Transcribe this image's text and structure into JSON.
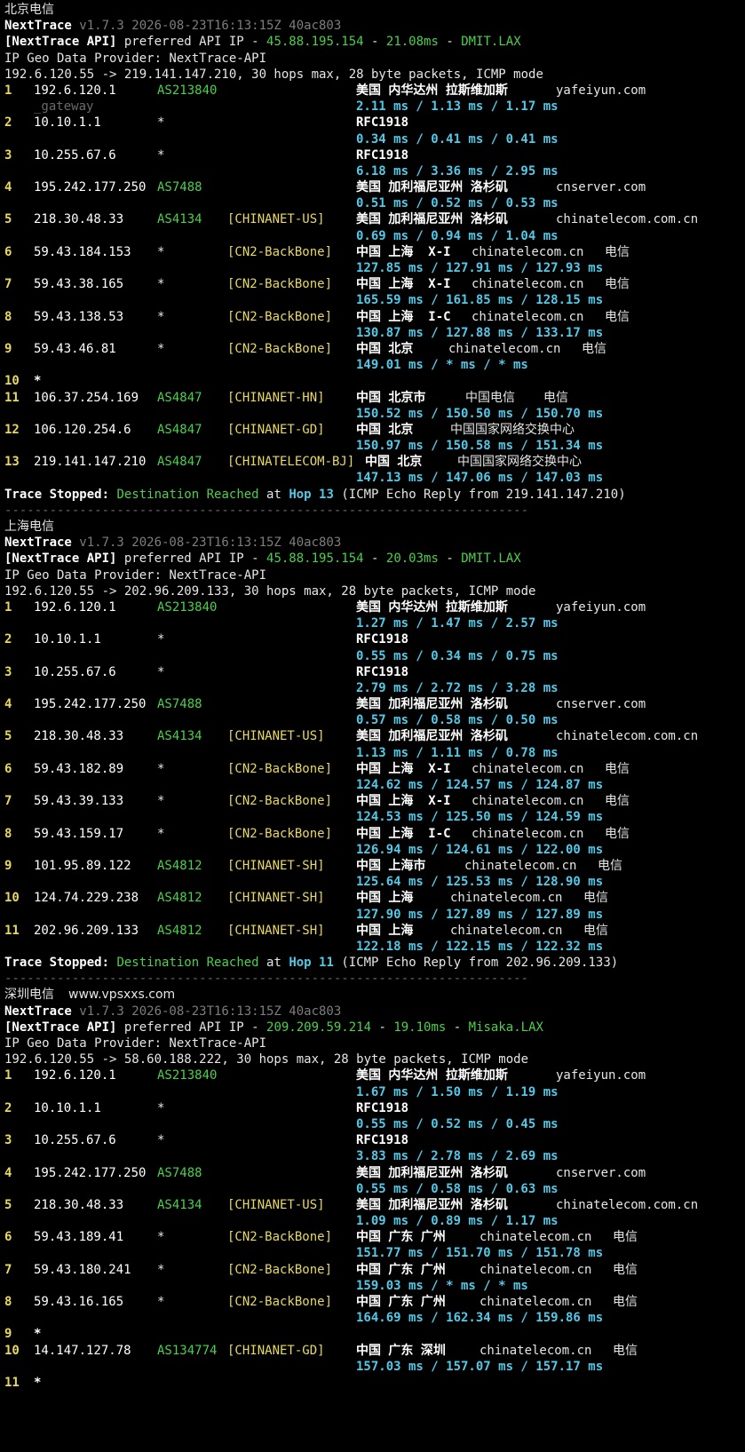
{
  "sections": [
    {
      "title": "北京电信",
      "extra": "",
      "version": "v1.7.3 2026-08-23T16:13:15Z 40ac803",
      "api_ip": "45.88.195.154",
      "api_latency": "21.08ms",
      "api_node": "DMIT.LAX",
      "geo_provider": "IP Geo Data Provider: NextTrace-API",
      "route": "192.6.120.55 -> 219.141.147.210, 30 hops max, 28 byte packets, ICMP mode",
      "hops": [
        {
          "n": "1",
          "ip": "192.6.120.1",
          "as": "AS213840",
          "tag": "",
          "geo": "美国 内华达州 拉斯维加斯",
          "dom": "yafeiyun.com",
          "isp": "",
          "dom_left": "621",
          "isp_left": "",
          "lat": "2.11 ms / 1.13 ms / 1.17 ms",
          "gw": "_gateway"
        },
        {
          "n": "2",
          "ip": "10.10.1.1",
          "as": "*",
          "tag": "",
          "geo": "RFC1918",
          "dom": "",
          "isp": "",
          "dom_left": "",
          "isp_left": "",
          "lat": "0.34 ms / 0.41 ms / 0.41 ms",
          "gw": ""
        },
        {
          "n": "3",
          "ip": "10.255.67.6",
          "as": "*",
          "tag": "",
          "geo": "RFC1918",
          "dom": "",
          "isp": "",
          "dom_left": "",
          "isp_left": "",
          "lat": "6.18 ms / 3.36 ms / 2.95 ms",
          "gw": ""
        },
        {
          "n": "4",
          "ip": "195.242.177.250",
          "as": "AS7488",
          "tag": "",
          "geo": "美国 加利福尼亚州 洛杉矶",
          "dom": "cnserver.com",
          "isp": "",
          "dom_left": "621",
          "isp_left": "",
          "lat": "0.51 ms / 0.52 ms / 0.53 ms",
          "gw": ""
        },
        {
          "n": "5",
          "ip": "218.30.48.33",
          "as": "AS4134",
          "tag": "[CHINANET-US]",
          "geo": "美国 加利福尼亚州 洛杉矶",
          "dom": "chinatelecom.com.cn",
          "isp": "",
          "dom_left": "621",
          "isp_left": "",
          "lat": "0.69 ms / 0.94 ms / 1.04 ms",
          "gw": ""
        },
        {
          "n": "6",
          "ip": "59.43.184.153",
          "as": "*",
          "tag": "[CN2-BackBone]",
          "geo": "中国 上海  X-I",
          "dom": "chinatelecom.cn",
          "isp": "电信",
          "dom_left": "526",
          "isp_left": "676",
          "lat": "127.85 ms / 127.91 ms / 127.93 ms",
          "gw": ""
        },
        {
          "n": "7",
          "ip": "59.43.38.165",
          "as": "*",
          "tag": "[CN2-BackBone]",
          "geo": "中国 上海  X-I",
          "dom": "chinatelecom.cn",
          "isp": "电信",
          "dom_left": "526",
          "isp_left": "676",
          "lat": "165.59 ms / 161.85 ms / 128.15 ms",
          "gw": ""
        },
        {
          "n": "8",
          "ip": "59.43.138.53",
          "as": "*",
          "tag": "[CN2-BackBone]",
          "geo": "中国 上海  I-C",
          "dom": "chinatelecom.cn",
          "isp": "电信",
          "dom_left": "526",
          "isp_left": "676",
          "lat": "130.87 ms / 127.88 ms / 133.17 ms",
          "gw": ""
        },
        {
          "n": "9",
          "ip": "59.43.46.81",
          "as": "*",
          "tag": "[CN2-BackBone]",
          "geo": "中国 北京",
          "dom": "chinatelecom.cn",
          "isp": "电信",
          "dom_left": "500",
          "isp_left": "650",
          "lat": "149.01 ms / * ms / * ms",
          "gw": ""
        },
        {
          "n": "10",
          "ip": "*",
          "as": "",
          "tag": "",
          "geo": "",
          "dom": "",
          "isp": "",
          "dom_left": "",
          "isp_left": "",
          "lat": "",
          "gw": ""
        },
        {
          "n": "11",
          "ip": "106.37.254.169",
          "as": "AS4847",
          "tag": "[CHINANET-HN]",
          "geo": "中国 北京市",
          "dom": "中国电信",
          "isp": "电信",
          "dom_left": "519",
          "isp_left": "607",
          "lat": "150.52 ms / 150.50 ms / 150.70 ms",
          "gw": ""
        },
        {
          "n": "12",
          "ip": "106.120.254.6",
          "as": "AS4847",
          "tag": "[CHINANET-GD]",
          "geo": "中国 北京",
          "dom": "中国国家网络交换中心",
          "isp": "",
          "dom_left": "502",
          "isp_left": "",
          "lat": "150.97 ms / 150.58 ms / 151.34 ms",
          "gw": ""
        },
        {
          "n": "13",
          "ip": "219.141.147.210",
          "as": "AS4847",
          "tag": "[CHINATELECOM-BJ]",
          "geo": "中国 北京",
          "dom": "中国国家网络交换中心",
          "isp": "",
          "dom_left": "510",
          "isp_left": "",
          "geo_left": "406",
          "lat": "147.13 ms / 147.06 ms / 147.03 ms",
          "gw": ""
        }
      ],
      "stop_hop": "Hop 13",
      "stop_from": "(ICMP Echo Reply from 219.141.147.210)",
      "show_sep": true
    },
    {
      "title": "上海电信",
      "extra": "",
      "version": "v1.7.3 2026-08-23T16:13:15Z 40ac803",
      "api_ip": "45.88.195.154",
      "api_latency": "20.03ms",
      "api_node": "DMIT.LAX",
      "geo_provider": "IP Geo Data Provider: NextTrace-API",
      "route": "192.6.120.55 -> 202.96.209.133, 30 hops max, 28 byte packets, ICMP mode",
      "hops": [
        {
          "n": "1",
          "ip": "192.6.120.1",
          "as": "AS213840",
          "tag": "",
          "geo": "美国 内华达州 拉斯维加斯",
          "dom": "yafeiyun.com",
          "isp": "",
          "dom_left": "621",
          "isp_left": "",
          "lat": "1.27 ms / 1.47 ms / 2.57 ms",
          "gw": ""
        },
        {
          "n": "2",
          "ip": "10.10.1.1",
          "as": "*",
          "tag": "",
          "geo": "RFC1918",
          "dom": "",
          "isp": "",
          "dom_left": "",
          "isp_left": "",
          "lat": "0.55 ms / 0.34 ms / 0.75 ms",
          "gw": ""
        },
        {
          "n": "3",
          "ip": "10.255.67.6",
          "as": "*",
          "tag": "",
          "geo": "RFC1918",
          "dom": "",
          "isp": "",
          "dom_left": "",
          "isp_left": "",
          "lat": "2.79 ms / 2.72 ms / 3.28 ms",
          "gw": ""
        },
        {
          "n": "4",
          "ip": "195.242.177.250",
          "as": "AS7488",
          "tag": "",
          "geo": "美国 加利福尼亚州 洛杉矶",
          "dom": "cnserver.com",
          "isp": "",
          "dom_left": "621",
          "isp_left": "",
          "lat": "0.57 ms / 0.58 ms / 0.50 ms",
          "gw": ""
        },
        {
          "n": "5",
          "ip": "218.30.48.33",
          "as": "AS4134",
          "tag": "[CHINANET-US]",
          "geo": "美国 加利福尼亚州 洛杉矶",
          "dom": "chinatelecom.com.cn",
          "isp": "",
          "dom_left": "621",
          "isp_left": "",
          "lat": "1.13 ms / 1.11 ms / 0.78 ms",
          "gw": ""
        },
        {
          "n": "6",
          "ip": "59.43.182.89",
          "as": "*",
          "tag": "[CN2-BackBone]",
          "geo": "中国 上海  X-I",
          "dom": "chinatelecom.cn",
          "isp": "电信",
          "dom_left": "526",
          "isp_left": "676",
          "lat": "124.62 ms / 124.57 ms / 124.87 ms",
          "gw": ""
        },
        {
          "n": "7",
          "ip": "59.43.39.133",
          "as": "*",
          "tag": "[CN2-BackBone]",
          "geo": "中国 上海  X-I",
          "dom": "chinatelecom.cn",
          "isp": "电信",
          "dom_left": "526",
          "isp_left": "676",
          "lat": "124.53 ms / 125.50 ms / 124.59 ms",
          "gw": ""
        },
        {
          "n": "8",
          "ip": "59.43.159.17",
          "as": "*",
          "tag": "[CN2-BackBone]",
          "geo": "中国 上海  I-C",
          "dom": "chinatelecom.cn",
          "isp": "电信",
          "dom_left": "526",
          "isp_left": "676",
          "lat": "126.94 ms / 124.61 ms / 122.00 ms",
          "gw": ""
        },
        {
          "n": "9",
          "ip": "101.95.89.122",
          "as": "AS4812",
          "tag": "[CHINANET-SH]",
          "geo": "中国 上海市",
          "dom": "chinatelecom.cn",
          "isp": "电信",
          "dom_left": "518",
          "isp_left": "668",
          "lat": "125.64 ms / 125.53 ms / 128.90 ms",
          "gw": ""
        },
        {
          "n": "10",
          "ip": "124.74.229.238",
          "as": "AS4812",
          "tag": "[CHINANET-SH]",
          "geo": "中国 上海",
          "dom": "chinatelecom.cn",
          "isp": "电信",
          "dom_left": "502",
          "isp_left": "652",
          "lat": "127.90 ms / 127.89 ms / 127.89 ms",
          "gw": ""
        },
        {
          "n": "11",
          "ip": "202.96.209.133",
          "as": "AS4812",
          "tag": "[CHINANET-SH]",
          "geo": "中国 上海",
          "dom": "chinatelecom.cn",
          "isp": "电信",
          "dom_left": "502",
          "isp_left": "652",
          "lat": "122.18 ms / 122.15 ms / 122.32 ms",
          "gw": ""
        }
      ],
      "stop_hop": "Hop 11",
      "stop_from": "(ICMP Echo Reply from 202.96.209.133)",
      "show_sep": true
    },
    {
      "title": "深圳电信",
      "extra": "www.vpsxxs.com",
      "version": "v1.7.3 2026-08-23T16:13:15Z 40ac803",
      "api_ip": "209.209.59.214",
      "api_latency": "19.10ms",
      "api_node": "Misaka.LAX",
      "geo_provider": "IP Geo Data Provider: NextTrace-API",
      "route": "192.6.120.55 -> 58.60.188.222, 30 hops max, 28 byte packets, ICMP mode",
      "hops": [
        {
          "n": "1",
          "ip": "192.6.120.1",
          "as": "AS213840",
          "tag": "",
          "geo": "美国 内华达州 拉斯维加斯",
          "dom": "yafeiyun.com",
          "isp": "",
          "dom_left": "621",
          "isp_left": "",
          "lat": "1.67 ms / 1.50 ms / 1.19 ms",
          "gw": ""
        },
        {
          "n": "2",
          "ip": "10.10.1.1",
          "as": "*",
          "tag": "",
          "geo": "RFC1918",
          "dom": "",
          "isp": "",
          "dom_left": "",
          "isp_left": "",
          "lat": "0.55 ms / 0.52 ms / 0.45 ms",
          "gw": ""
        },
        {
          "n": "3",
          "ip": "10.255.67.6",
          "as": "*",
          "tag": "",
          "geo": "RFC1918",
          "dom": "",
          "isp": "",
          "dom_left": "",
          "isp_left": "",
          "lat": "3.83 ms / 2.78 ms / 2.69 ms",
          "gw": ""
        },
        {
          "n": "4",
          "ip": "195.242.177.250",
          "as": "AS7488",
          "tag": "",
          "geo": "美国 加利福尼亚州 洛杉矶",
          "dom": "cnserver.com",
          "isp": "",
          "dom_left": "621",
          "isp_left": "",
          "lat": "0.55 ms / 0.58 ms / 0.63 ms",
          "gw": ""
        },
        {
          "n": "5",
          "ip": "218.30.48.33",
          "as": "AS4134",
          "tag": "[CHINANET-US]",
          "geo": "美国 加利福尼亚州 洛杉矶",
          "dom": "chinatelecom.com.cn",
          "isp": "",
          "dom_left": "621",
          "isp_left": "",
          "lat": "1.09 ms / 0.89 ms / 1.17 ms",
          "gw": ""
        },
        {
          "n": "6",
          "ip": "59.43.189.41",
          "as": "*",
          "tag": "[CN2-BackBone]",
          "geo": "中国 广东 广州",
          "dom": "chinatelecom.cn",
          "isp": "电信",
          "dom_left": "535",
          "isp_left": "685",
          "lat": "151.77 ms / 151.70 ms / 151.78 ms",
          "gw": ""
        },
        {
          "n": "7",
          "ip": "59.43.180.241",
          "as": "*",
          "tag": "[CN2-BackBone]",
          "geo": "中国 广东 广州",
          "dom": "chinatelecom.cn",
          "isp": "电信",
          "dom_left": "535",
          "isp_left": "685",
          "lat": "159.03 ms / * ms / * ms",
          "gw": ""
        },
        {
          "n": "8",
          "ip": "59.43.16.165",
          "as": "*",
          "tag": "[CN2-BackBone]",
          "geo": "中国 广东 广州",
          "dom": "chinatelecom.cn",
          "isp": "电信",
          "dom_left": "535",
          "isp_left": "685",
          "lat": "164.69 ms / 162.34 ms / 159.86 ms",
          "gw": ""
        },
        {
          "n": "9",
          "ip": "*",
          "as": "",
          "tag": "",
          "geo": "",
          "dom": "",
          "isp": "",
          "dom_left": "",
          "isp_left": "",
          "lat": "",
          "gw": ""
        },
        {
          "n": "10",
          "ip": "14.147.127.78",
          "as": "AS134774",
          "tag": "[CHINANET-GD]",
          "geo": "中国 广东 深圳",
          "dom": "chinatelecom.cn",
          "isp": "电信",
          "dom_left": "535",
          "isp_left": "685",
          "lat": "157.03 ms / 157.07 ms / 157.17 ms",
          "gw": ""
        },
        {
          "n": "11",
          "ip": "*",
          "as": "",
          "tag": "",
          "geo": "",
          "dom": "",
          "isp": "",
          "dom_left": "",
          "isp_left": "",
          "lat": "",
          "gw": ""
        }
      ],
      "stop_hop": "",
      "stop_from": "",
      "show_sep": false
    }
  ],
  "labels": {
    "app_name": "NextTrace",
    "api_prefix": "[NextTrace API]",
    "api_text": " preferred API IP - ",
    "dash": " - ",
    "trace_stopped": "Trace Stopped:",
    "dest_reached": "Destination Reached",
    "at": "at",
    "separator": "----------------------------------------------------------------------"
  },
  "colors": {
    "background": "#000000",
    "text": "#e6e6e6",
    "green": "#4cd04c",
    "cyan": "#53c9e8",
    "yellow": "#e8d860",
    "dim": "#7d7d7d"
  }
}
